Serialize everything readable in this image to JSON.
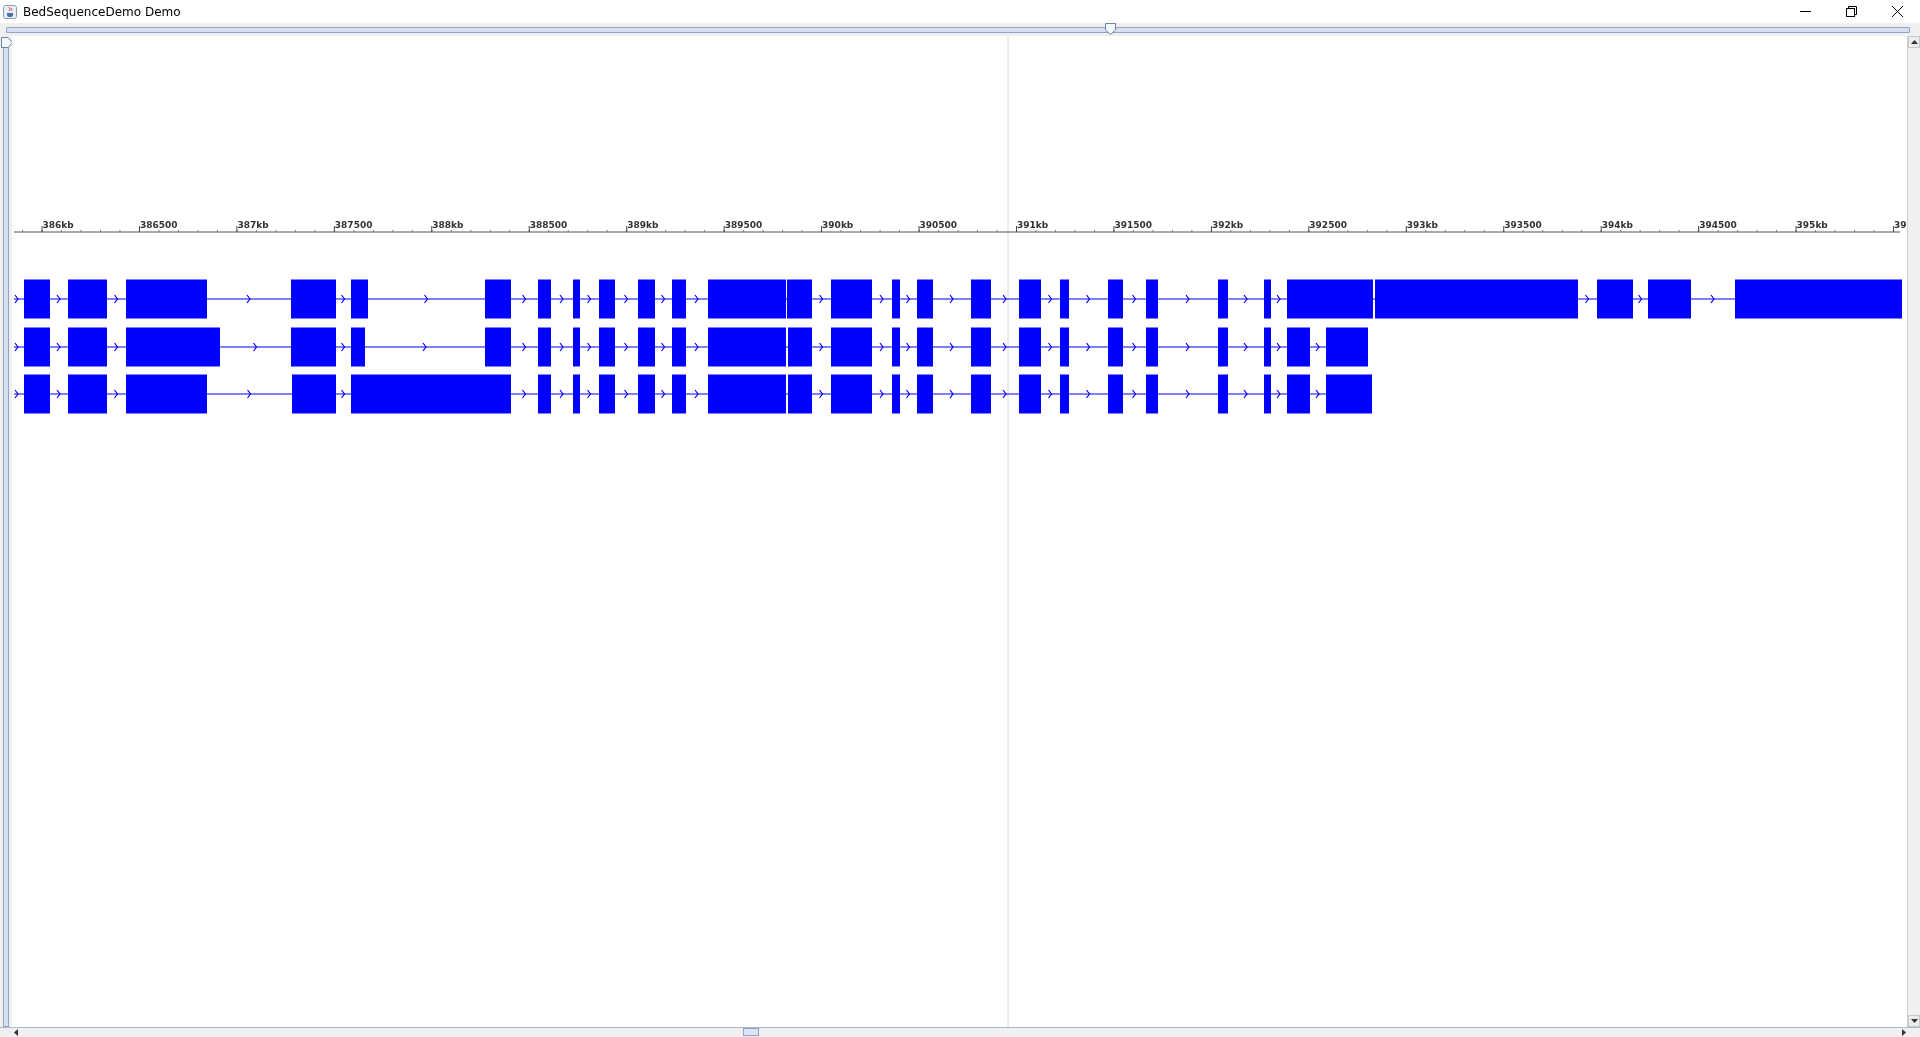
{
  "window": {
    "title": "BedSequenceDemo Demo"
  },
  "zoom_slider": {
    "level": 0.58
  },
  "vertical_slider": {
    "level": 0
  },
  "ruler": {
    "tick_labels": [
      "386kb",
      "386500",
      "387kb",
      "387500",
      "388kb",
      "388500",
      "389kb",
      "389500",
      "390kb",
      "390500",
      "391kb",
      "391500",
      "392kb",
      "392500",
      "393kb",
      "393500",
      "394kb",
      "394500",
      "395kb",
      "39"
    ]
  }
}
